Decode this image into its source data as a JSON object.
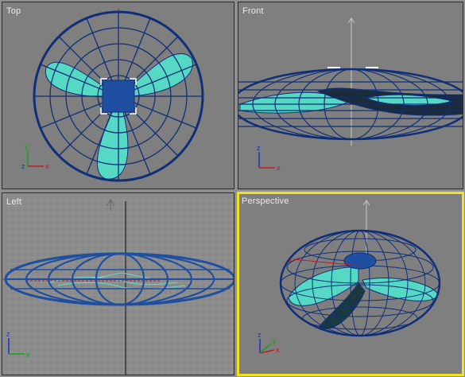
{
  "viewports": {
    "top": {
      "label": "Top",
      "active": false
    },
    "front": {
      "label": "Front",
      "active": false
    },
    "left": {
      "label": "Left",
      "active": false
    },
    "perspective": {
      "label": "Perspective",
      "active": true
    }
  },
  "axis_labels": {
    "x": "x",
    "y": "y",
    "z": "z"
  },
  "colors": {
    "viewport_bg": "#7f7f7f",
    "active_border": "#f2e11f",
    "wire": "#0f2f78",
    "blade_fill": "#55d9c4",
    "blade_dark": "#1b3a40",
    "hub": "#1e4fa0",
    "grid": "#9a9a9a",
    "axis_red": "#c0182a",
    "axis_green": "#1aa01a",
    "axis_blue": "#2030c0"
  }
}
